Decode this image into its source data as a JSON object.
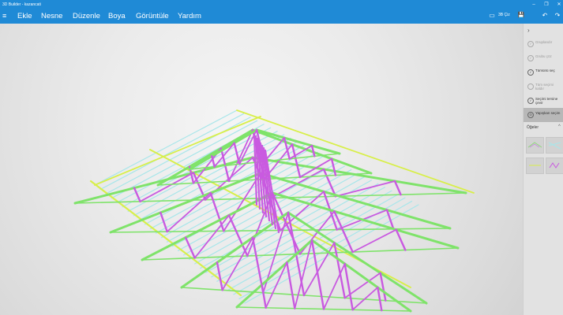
{
  "window": {
    "title": "3D Builder - kazancati",
    "min_glyph": "–",
    "restore_glyph": "❐",
    "close_glyph": "✕"
  },
  "menu": {
    "hamburger_glyph": "≡",
    "items": [
      "Ekle",
      "Nesne",
      "Düzenle",
      "Boya",
      "Görüntüle",
      "Yardım"
    ]
  },
  "toolbar": {
    "print_label": "3B Çiz",
    "save_glyph": "💾",
    "undo_glyph": "↶",
    "redo_glyph": "↷"
  },
  "panel": {
    "collapse_glyph": "›",
    "items": [
      {
        "label": "Gruplandır",
        "state": "disabled",
        "glyph": "✓"
      },
      {
        "label": "Grubu çöz",
        "state": "disabled",
        "glyph": "✓"
      },
      {
        "label": "Tümünü seç",
        "state": "normal",
        "glyph": "✓"
      },
      {
        "label": "Tüm seçimi kaldır",
        "state": "disabled",
        "glyph": ""
      },
      {
        "label": "Seçimi tersine çevir",
        "state": "normal",
        "glyph": "✓"
      },
      {
        "label": "Yapışkan seçim",
        "state": "selected",
        "glyph": "⊙"
      }
    ],
    "section_title": "Öğeler",
    "section_chevron": "^"
  },
  "colors": {
    "accent": "#1f8ad6",
    "truss_top": "#d8ef4a",
    "truss_green": "#7fe36a",
    "truss_magenta": "#c95ae0",
    "rafter": "#a8e6ea"
  }
}
